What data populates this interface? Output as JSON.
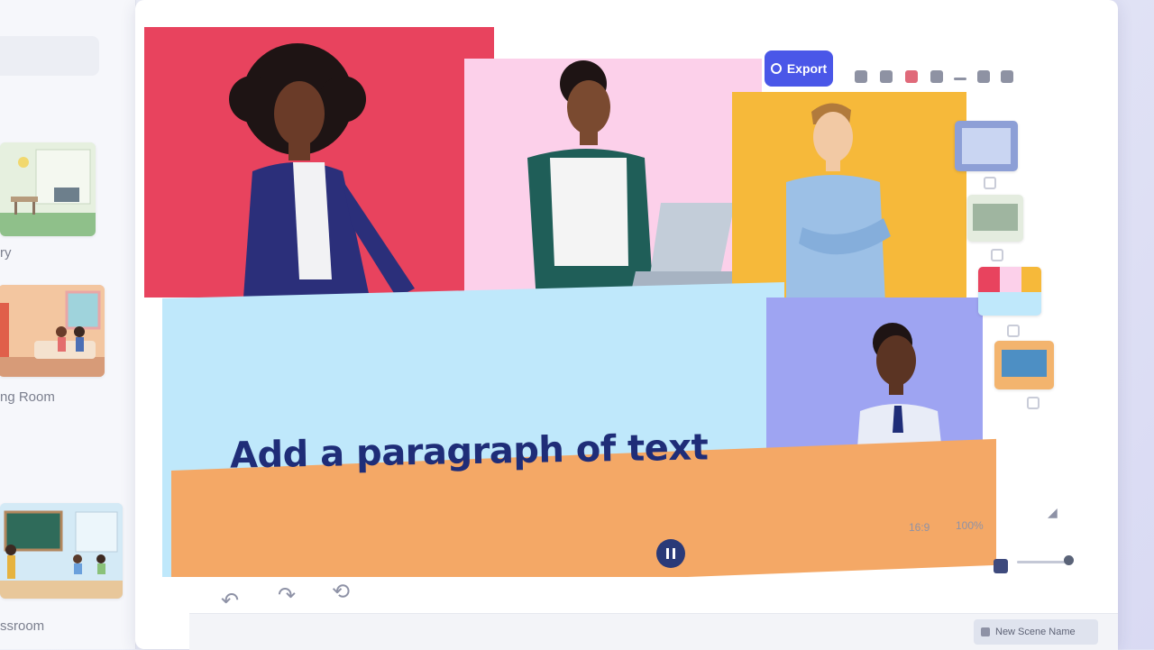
{
  "sidebar": {
    "templates": [
      {
        "label": "ry"
      },
      {
        "label": "ng Room"
      },
      {
        "label": "ssroom"
      }
    ]
  },
  "toolbar": {
    "export_label": "Export"
  },
  "canvas": {
    "headline": "Add a paragraph of text"
  },
  "controls": {
    "aspect_ratio": "16:9",
    "zoom": "100%"
  },
  "timeline": {
    "scene_label": "New Scene Name"
  },
  "colors": {
    "accent": "#4a57e8",
    "panel_red": "#e8435e",
    "panel_pink": "#fcd0ea",
    "panel_yellow": "#f6b93a",
    "panel_lightblue": "#bfe8fb",
    "panel_lavender": "#9ea4f2",
    "panel_orange": "#f4a866"
  }
}
